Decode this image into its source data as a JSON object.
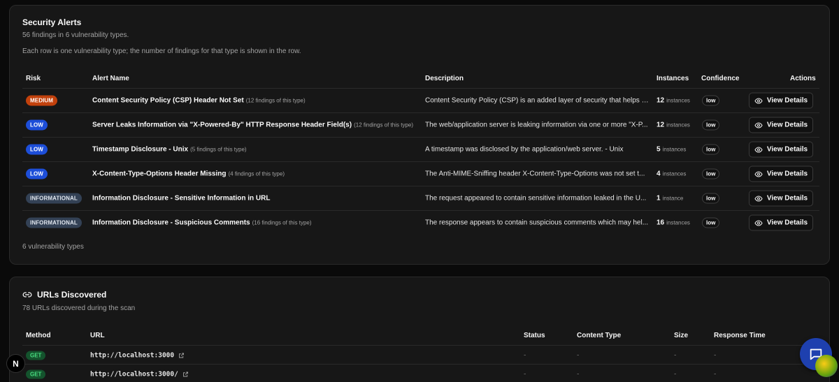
{
  "alerts": {
    "title": "Security Alerts",
    "summary": "56 findings in 6 vulnerability types.",
    "note": "Each row is one vulnerability type; the number of findings for that type is shown in the row.",
    "columns": {
      "risk": "Risk",
      "name": "Alert Name",
      "description": "Description",
      "instances": "Instances",
      "confidence": "Confidence",
      "actions": "Actions"
    },
    "rows": [
      {
        "risk": "MEDIUM",
        "name": "Content Security Policy (CSP) Header Not Set",
        "count": "(12 findings of this type)",
        "description": "Content Security Policy (CSP) is an added layer of security that helps to...",
        "instances": "12",
        "unit": "instances",
        "confidence": "low",
        "action": "View Details"
      },
      {
        "risk": "LOW",
        "name": "Server Leaks Information via \"X-Powered-By\" HTTP Response Header Field(s)",
        "count": "(12 findings of this type)",
        "description": "The web/application server is leaking information via one or more \"X-P...",
        "instances": "12",
        "unit": "instances",
        "confidence": "low",
        "action": "View Details"
      },
      {
        "risk": "LOW",
        "name": "Timestamp Disclosure - Unix",
        "count": "(5 findings of this type)",
        "description": "A timestamp was disclosed by the application/web server. - Unix",
        "instances": "5",
        "unit": "instances",
        "confidence": "low",
        "action": "View Details"
      },
      {
        "risk": "LOW",
        "name": "X-Content-Type-Options Header Missing",
        "count": "(4 findings of this type)",
        "description": "The Anti-MIME-Sniffing header X-Content-Type-Options was not set t...",
        "instances": "4",
        "unit": "instances",
        "confidence": "low",
        "action": "View Details"
      },
      {
        "risk": "INFORMATIONAL",
        "name": "Information Disclosure - Sensitive Information in URL",
        "count": "",
        "description": "The request appeared to contain sensitive information leaked in the U...",
        "instances": "1",
        "unit": "instance",
        "confidence": "low",
        "action": "View Details"
      },
      {
        "risk": "INFORMATIONAL",
        "name": "Information Disclosure - Suspicious Comments",
        "count": "(16 findings of this type)",
        "description": "The response appears to contain suspicious comments which may hel...",
        "instances": "16",
        "unit": "instances",
        "confidence": "low",
        "action": "View Details"
      }
    ],
    "footer": "6 vulnerability types"
  },
  "urls": {
    "title": "URLs Discovered",
    "summary": "78 URLs discovered during the scan",
    "columns": {
      "method": "Method",
      "url": "URL",
      "status": "Status",
      "content_type": "Content Type",
      "size": "Size",
      "response_time": "Response Time"
    },
    "rows": [
      {
        "method": "GET",
        "url": "http://localhost:3000",
        "status": "-",
        "content_type": "-",
        "size": "-",
        "response_time": "-"
      },
      {
        "method": "GET",
        "url": "http://localhost:3000/",
        "status": "-",
        "content_type": "-",
        "size": "-",
        "response_time": "-"
      }
    ]
  },
  "next_badge": "N",
  "colors": {
    "medium": "#c2410c",
    "low": "#1d4ed8",
    "informational": "#334155",
    "get": "#14532d",
    "fab": "#1e40af"
  },
  "icons": {
    "view": "eye-icon",
    "link": "link-icon",
    "external": "external-link-icon",
    "chat": "chat-icon"
  }
}
